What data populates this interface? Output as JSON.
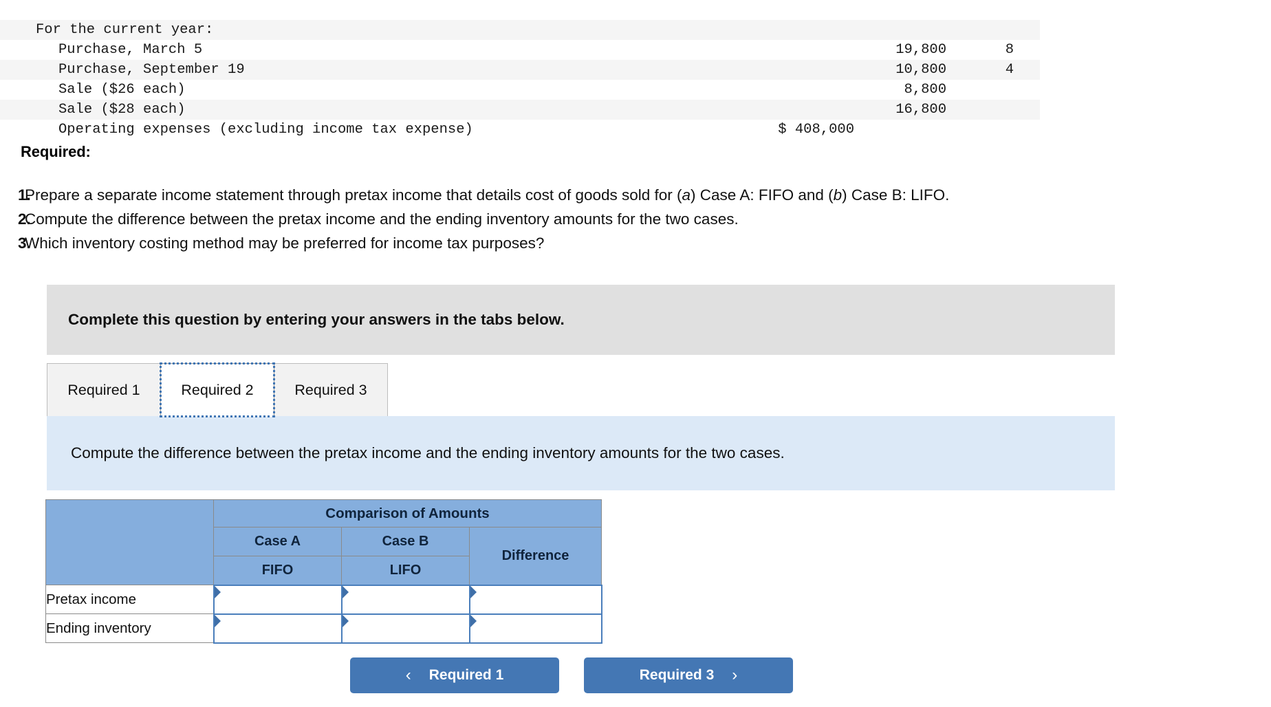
{
  "data_table": {
    "rows": [
      {
        "label": "",
        "indent": 2,
        "mid": "",
        "num": "",
        "qty": "",
        "clipped": true,
        "alt": false
      },
      {
        "label": "For the current year:",
        "indent": 1,
        "mid": "",
        "num": "",
        "qty": "",
        "alt": true
      },
      {
        "label": "Purchase, March 5",
        "indent": 2,
        "mid": "",
        "num": "19,800",
        "qty": "8",
        "alt": false
      },
      {
        "label": "Purchase, September 19",
        "indent": 2,
        "mid": "",
        "num": "10,800",
        "qty": "4",
        "alt": true
      },
      {
        "label": "Sale ($26 each)",
        "indent": 2,
        "mid": "",
        "num": "8,800",
        "qty": "",
        "alt": false
      },
      {
        "label": "Sale ($28 each)",
        "indent": 2,
        "mid": "",
        "num": "16,800",
        "qty": "",
        "alt": true
      },
      {
        "label": "Operating expenses (excluding income tax expense)",
        "indent": 2,
        "mid": "$ 408,000",
        "num": "",
        "qty": "",
        "alt": false
      }
    ]
  },
  "required": {
    "heading": "Required:",
    "items": [
      {
        "number": "1.",
        "text_before": "Prepare a separate income statement through pretax income that details cost of goods sold for (",
        "em_a": "a",
        "text_mid": ") Case A: FIFO and (",
        "em_b": "b",
        "text_after": ") Case B: LIFO."
      },
      {
        "number": "2.",
        "text": "Compute the difference between the pretax income and the ending inventory amounts for the two cases."
      },
      {
        "number": "3.",
        "text": "Which inventory costing method may be preferred for income tax purposes?"
      }
    ]
  },
  "complete_banner": {
    "text": "Complete this question by entering your answers in the tabs below."
  },
  "tabs": [
    {
      "label": "Required 1",
      "active": false
    },
    {
      "label": "Required 2",
      "active": true
    },
    {
      "label": "Required 3",
      "active": false
    }
  ],
  "tab_instruction": {
    "text": "Compute the difference between the pretax income and the ending inventory amounts for the two cases."
  },
  "answer_table": {
    "group_header": "Comparison of Amounts",
    "case_a": "Case A",
    "case_b": "Case B",
    "method_a": "FIFO",
    "method_b": "LIFO",
    "difference": "Difference",
    "rows": [
      {
        "label": "Pretax income",
        "case_a": "",
        "case_b": "",
        "difference": ""
      },
      {
        "label": "Ending inventory",
        "case_a": "",
        "case_b": "",
        "difference": ""
      }
    ]
  },
  "nav": {
    "prev_label": "Required 1",
    "next_label": "Required 3",
    "prev_chevron": "‹",
    "next_chevron": "›"
  },
  "colors": {
    "header_blue": "#85aedd",
    "cell_border_blue": "#4a7ebb",
    "button_blue": "#4477b4",
    "banner_gray": "#e0e0e0",
    "instruction_blue": "#dce9f7"
  }
}
